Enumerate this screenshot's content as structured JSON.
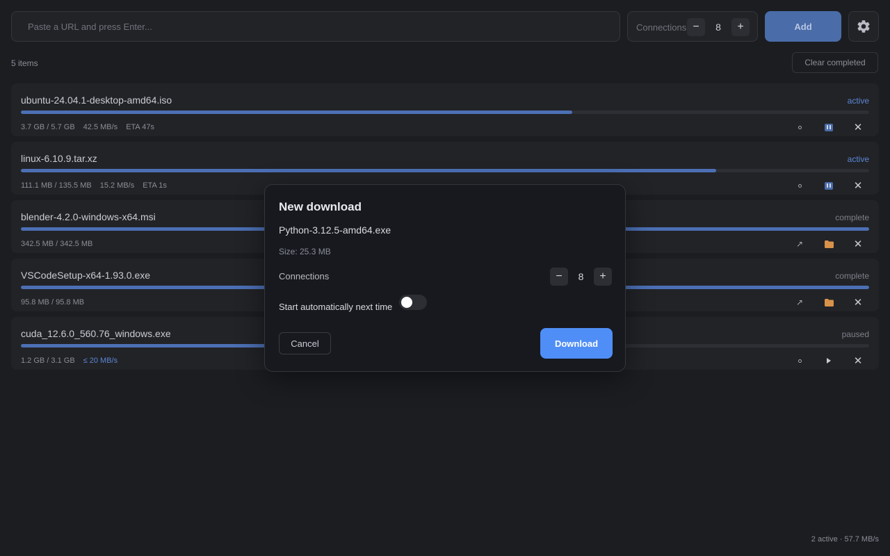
{
  "toolbar": {
    "url_placeholder": "Paste a URL and press Enter...",
    "connections_label": "Connections",
    "connections_value": "8",
    "minus_label": "−",
    "plus_label": "+",
    "add_label": "Add",
    "settings_icon": "gear-icon"
  },
  "list_header": {
    "items_count": "5 items",
    "clear_label": "Clear completed"
  },
  "downloads": [
    {
      "name": "ubuntu-24.04.1-desktop-amd64.iso",
      "status": "active",
      "progress": 0.65,
      "size_text": "3.7 GB / 5.7 GB",
      "speed": "42.5 MB/s",
      "eta": "ETA 47s"
    },
    {
      "name": "linux-6.10.9.tar.xz",
      "status": "active",
      "progress": 0.82,
      "size_text": "111.1 MB / 135.5 MB",
      "speed": "15.2 MB/s",
      "eta": "ETA 1s"
    },
    {
      "name": "blender-4.2.0-windows-x64.msi",
      "status": "complete",
      "progress": 1.0,
      "size_text": "342.5 MB / 342.5 MB"
    },
    {
      "name": "VSCodeSetup-x64-1.93.0.exe",
      "status": "complete",
      "progress": 1.0,
      "size_text": "95.8 MB / 95.8 MB"
    },
    {
      "name": "cuda_12.6.0_560.76_windows.exe",
      "status": "paused",
      "progress": 0.39,
      "size_text": "1.2 GB / 3.1 GB",
      "limit": "≤ 20 MB/s"
    }
  ],
  "modal": {
    "title": "New download",
    "file_name": "Python-3.12.5-amd64.exe",
    "size": "Size: 25.3 MB",
    "connections_label": "Connections",
    "connections_value": "8",
    "auto_start_label": "Start automatically next time",
    "auto_start_enabled": false,
    "cancel_label": "Cancel",
    "download_label": "Download"
  },
  "footer": {
    "summary": "2 active · 57.7 MB/s"
  },
  "colors": {
    "accent": "#4f8ef6",
    "active_status": "#5b86d4",
    "progress_fill": "#4c6fb4",
    "folder": "#d9924a"
  }
}
